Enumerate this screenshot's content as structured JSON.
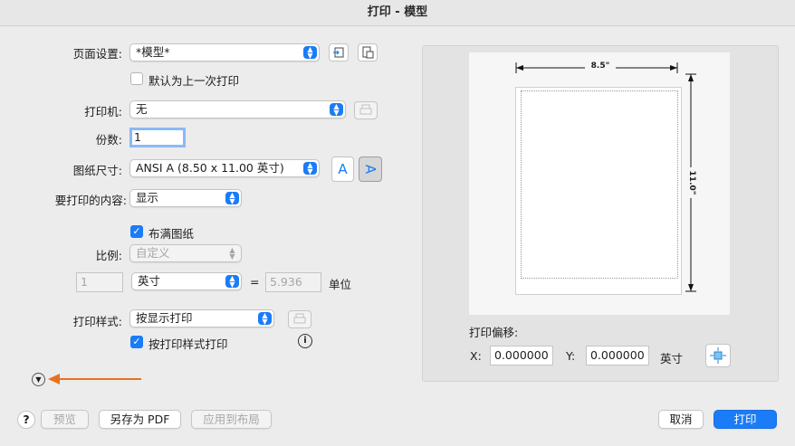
{
  "window": {
    "title": "打印 - 模型"
  },
  "page_setup": {
    "label": "页面设置:",
    "value": "*模型*",
    "default_checkbox_label": "默认为上一次打印",
    "default_checked": false
  },
  "printer": {
    "label": "打印机:",
    "value": "无"
  },
  "copies": {
    "label": "份数:",
    "value": "1"
  },
  "paper_size": {
    "label": "图纸尺寸:",
    "value": "ANSI A (8.50 x 11.00 英寸)",
    "portrait_glyph": "A",
    "landscape_glyph": "A"
  },
  "what_to_print": {
    "label": "要打印的内容:",
    "value": "显示"
  },
  "fit_to_paper": {
    "label": "布满图纸",
    "checked": true
  },
  "scale": {
    "label": "比例:",
    "value": "自定义",
    "left_value": "1",
    "unit": "英寸",
    "equals": "=",
    "right_value": "5.936",
    "right_unit": "单位"
  },
  "plot_style": {
    "label": "打印样式:",
    "value": "按显示打印",
    "checkbox_label": "按打印样式打印",
    "checked": true,
    "info_glyph": "i"
  },
  "preview": {
    "width_label": "8.5\"",
    "height_label": "11.0\""
  },
  "offset": {
    "title": "打印偏移:",
    "x_label": "X:",
    "x_value": "0.000000",
    "y_label": "Y:",
    "y_value": "0.000000",
    "unit": "英寸"
  },
  "footer": {
    "help": "?",
    "preview": "预览",
    "save_pdf": "另存为 PDF",
    "apply_layout": "应用到布局",
    "cancel": "取消",
    "print": "打印"
  },
  "colors": {
    "accent": "#1a7cf7",
    "arrow": "#e8721c"
  }
}
